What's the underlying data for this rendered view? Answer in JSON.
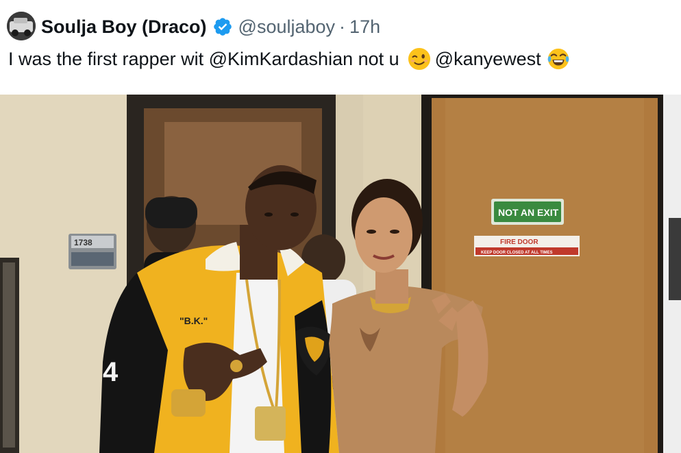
{
  "tweet": {
    "author": {
      "display_name": "Soulja Boy (Draco)",
      "verified": true,
      "handle": "@souljaboy",
      "separator": "·",
      "time": "17h",
      "avatar_icon": "avatar-photo"
    },
    "text": {
      "part1": "I was the first rapper wit @KimKardashian not u",
      "emoji1": "winking-face-emoji",
      "part2": "@kanyewest",
      "emoji2": "face-with-tears-of-joy-emoji"
    },
    "photo": {
      "sign_not_exit": "NOT AN EXIT",
      "sign_fire_door": "FIRE DOOR",
      "sign_fire_door_sub": "KEEP DOOR CLOSED AT ALL TIMES",
      "room_number": "1738",
      "jacket_text": "\"B.K.\"",
      "jacket_number": "4"
    },
    "colors": {
      "verified_blue": "#1d9bf0",
      "text_primary": "#0f1419",
      "text_secondary": "#536471",
      "sign_green": "#3a8a3f",
      "jacket_yellow": "#f0b21f"
    }
  }
}
